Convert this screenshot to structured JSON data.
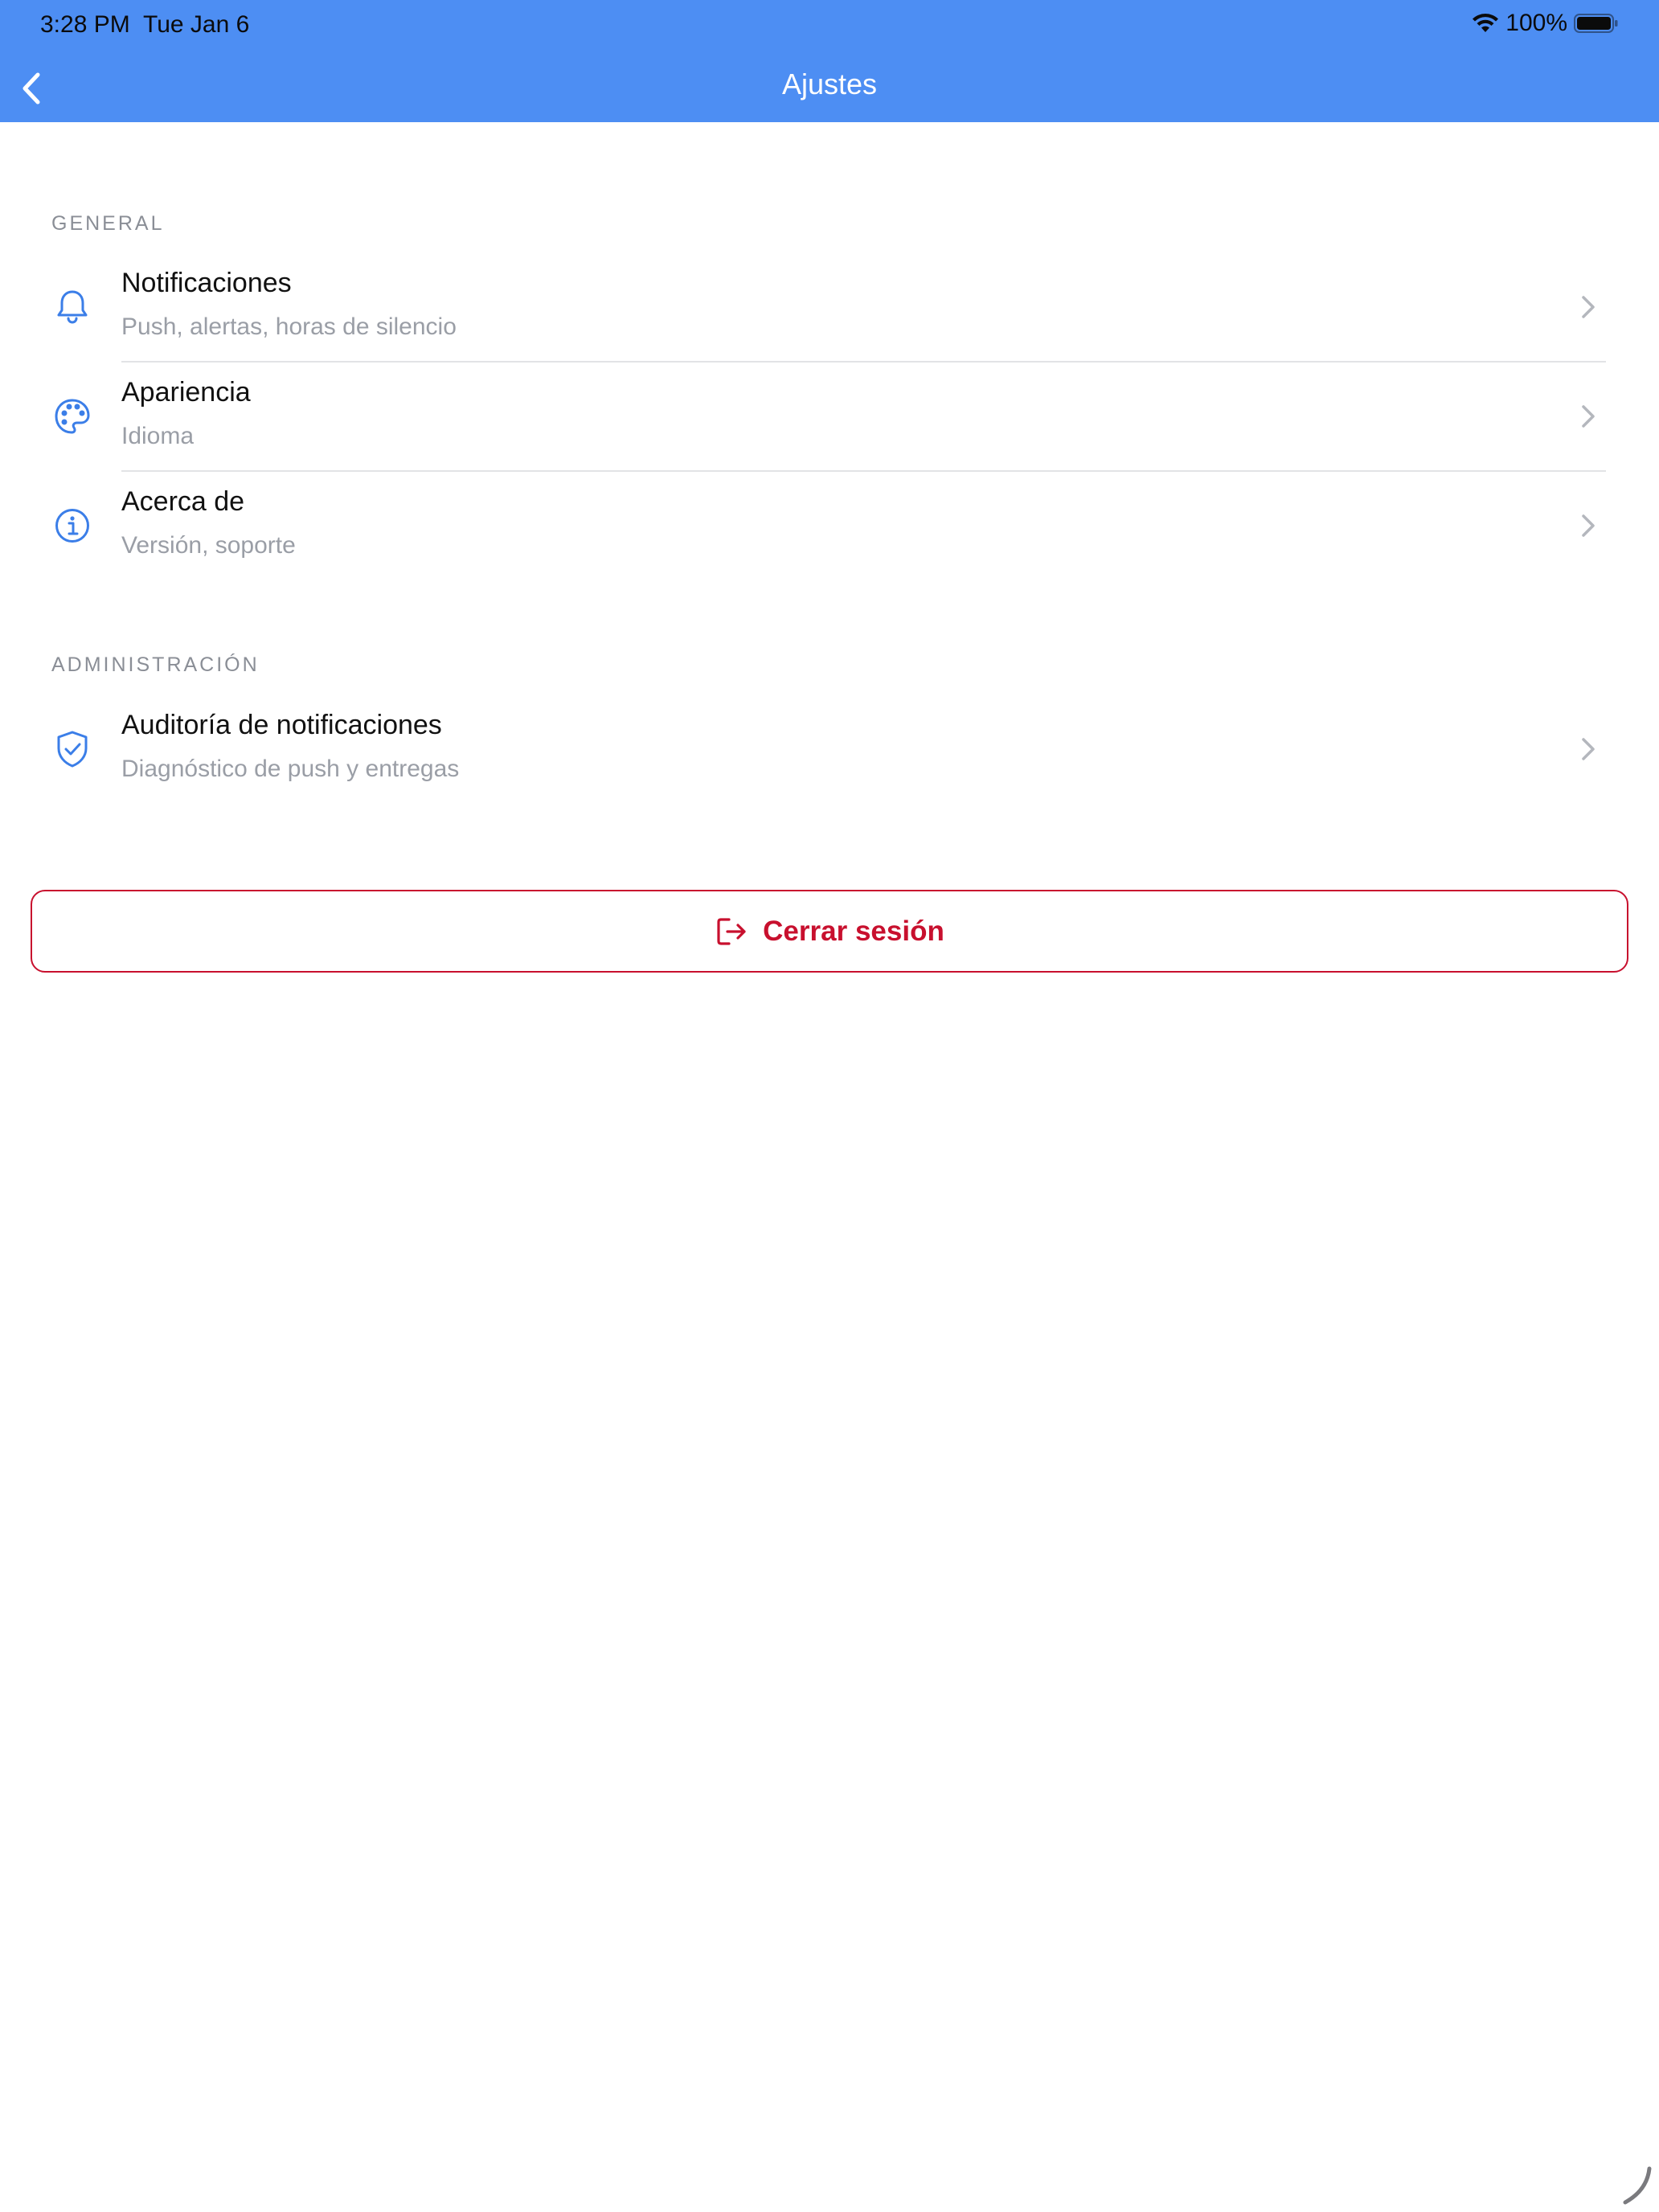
{
  "status_bar": {
    "time": "3:28 PM",
    "date": "Tue Jan 6",
    "battery": "100%"
  },
  "nav": {
    "title": "Ajustes",
    "back_icon": "chevron-left-icon"
  },
  "sections": [
    {
      "label": "GENERAL",
      "items": [
        {
          "title": "Notificaciones",
          "subtitle": "Push, alertas, horas de silencio",
          "icon": "bell-icon"
        },
        {
          "title": "Apariencia",
          "subtitle": "Idioma",
          "icon": "palette-icon"
        },
        {
          "title": "Acerca de",
          "subtitle": "Versión, soporte",
          "icon": "info-icon"
        }
      ]
    },
    {
      "label": "ADMINISTRACIÓN",
      "items": [
        {
          "title": "Auditoría de notificaciones",
          "subtitle": "Diagnóstico de push y entregas",
          "icon": "shield-check-icon"
        }
      ]
    }
  ],
  "logout": {
    "label": "Cerrar sesión",
    "icon": "logout-icon"
  },
  "colors": {
    "header": "#4d8ef3",
    "icon_accent": "#3b7ee8",
    "danger": "#c8102e",
    "section_label": "#8a8e96",
    "subtitle": "#9a9ea6"
  }
}
